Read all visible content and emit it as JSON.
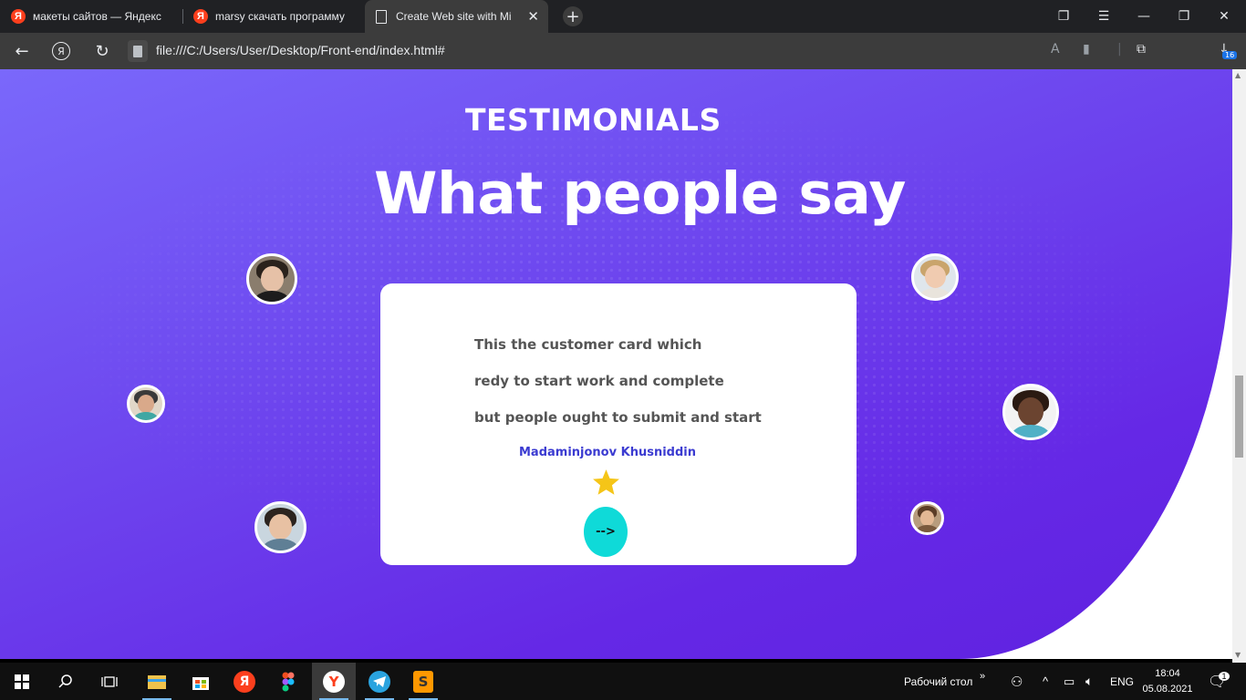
{
  "browser": {
    "tabs": [
      {
        "title": "макеты сайтов — Яндекс",
        "favicon": "yandex-icon"
      },
      {
        "title": "marsy скачать программу",
        "favicon": "yandex-icon"
      },
      {
        "title": "Create Web site with Mi",
        "favicon": "document-icon",
        "active": true
      }
    ],
    "favicon_letter": "Я",
    "url": "file:///C:/Users/User/Desktop/Front-end/index.html#",
    "download_badge": "16",
    "accent": "#1a73e8"
  },
  "page": {
    "eyebrow": "TESTIMONIALS",
    "headline": "What people say",
    "card": {
      "lines": [
        "This the customer card which",
        "redy to start work and complete",
        "but people ought to submit and start"
      ],
      "author": "Madaminjonov Khusniddin",
      "next_label": "-->"
    },
    "colors": {
      "gradient_start": "#7a68fb",
      "gradient_end": "#5f22df",
      "button": "#0fdad8",
      "author": "#3b3bd1",
      "star": "#f5c518"
    }
  },
  "taskbar": {
    "desktop_label": "Рабочий стол",
    "language": "ENG",
    "time": "18:04",
    "date": "05.08.2021",
    "notification_count": "1"
  }
}
